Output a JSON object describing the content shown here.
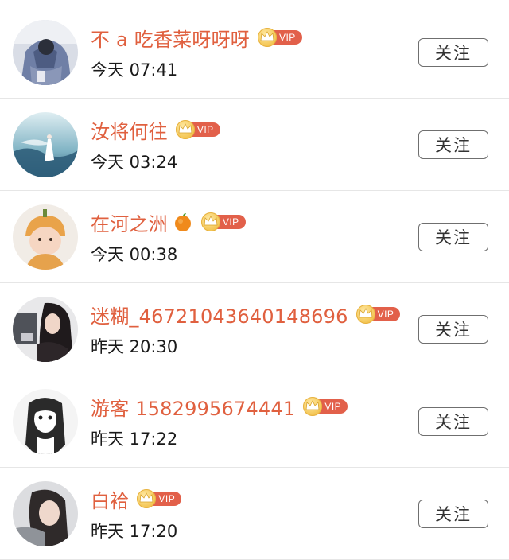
{
  "users": [
    {
      "name": "不 a 吃香菜呀呀呀",
      "time": "今天 07:41",
      "vip": "VIP",
      "follow": "关注",
      "avatar_icon": "avatar-hoodie-photo",
      "emoji": null
    },
    {
      "name": "汝将何往",
      "time": "今天 03:24",
      "vip": "VIP",
      "follow": "关注",
      "avatar_icon": "avatar-sky-figure",
      "emoji": null
    },
    {
      "name": "在河之洲",
      "time": "今天 00:38",
      "vip": "VIP",
      "follow": "关注",
      "avatar_icon": "avatar-baby-hat",
      "emoji": "orange-emoji"
    },
    {
      "name": "迷糊_46721043640148696",
      "time": "昨天 20:30",
      "vip": "VIP",
      "follow": "关注",
      "avatar_icon": "avatar-girl-phone",
      "emoji": null
    },
    {
      "name": "游客 1582995674441",
      "time": "昨天 17:22",
      "vip": "VIP",
      "follow": "关注",
      "avatar_icon": "avatar-anime-sketch",
      "emoji": null
    },
    {
      "name": "白袷",
      "time": "昨天 17:20",
      "vip": "VIP",
      "follow": "关注",
      "avatar_icon": "avatar-woman-portrait",
      "emoji": null
    }
  ],
  "colors": {
    "name": "#e0603f",
    "vip_badge": "#e2604a",
    "crown": "#f3c451",
    "divider": "#e6e6e6",
    "button_border": "#6f6f6f"
  }
}
